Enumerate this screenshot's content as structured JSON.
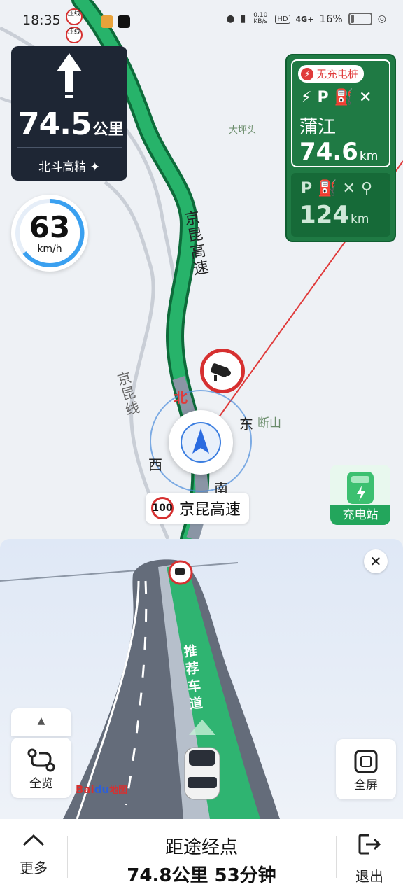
{
  "status_bar": {
    "time": "18:35",
    "notifications": [
      "压线",
      "压线"
    ],
    "net_speed": "0.10 KB/s",
    "hd": "HD",
    "network": "4G+",
    "battery": "16%",
    "battery_level": 0.16
  },
  "turn_card": {
    "direction_icon": "straight-arrow-icon",
    "distance_value": "74.5",
    "distance_unit": "公里",
    "positioning": "北斗高精"
  },
  "speedometer": {
    "speed": "63",
    "unit": "km/h"
  },
  "service_area": {
    "badge": "无充电桩",
    "first": {
      "icons": [
        "charging-icon",
        "parking-icon",
        "fuel-icon",
        "restaurant-icon"
      ],
      "name": "蒲江",
      "distance_value": "74.6",
      "distance_unit": "km"
    },
    "second": {
      "icons": [
        "parking-icon",
        "fuel-icon",
        "restaurant-icon",
        "restroom-icon"
      ],
      "distance_value": "124",
      "distance_unit": "km"
    }
  },
  "map": {
    "place_labels": [
      "大坪头",
      "断山"
    ],
    "road_labels": [
      "京昆高速",
      "京昆线"
    ],
    "compass": {
      "north": "北",
      "east": "东",
      "south": "南",
      "west": "西"
    },
    "current_road": {
      "speed_limit": "100",
      "name": "京昆高速"
    },
    "charging_station_button": "充电站"
  },
  "lane_view": {
    "recommended_lane": "推荐车道",
    "overview_button": "全览",
    "fullscreen_button": "全屏",
    "brand": {
      "prefix": "Bai",
      "middle": "du",
      "suffix": "地图"
    }
  },
  "bottom_bar": {
    "more_button": "更多",
    "title": "距途经点",
    "remaining": "74.8公里 53分钟",
    "exit_button": "退出"
  }
}
